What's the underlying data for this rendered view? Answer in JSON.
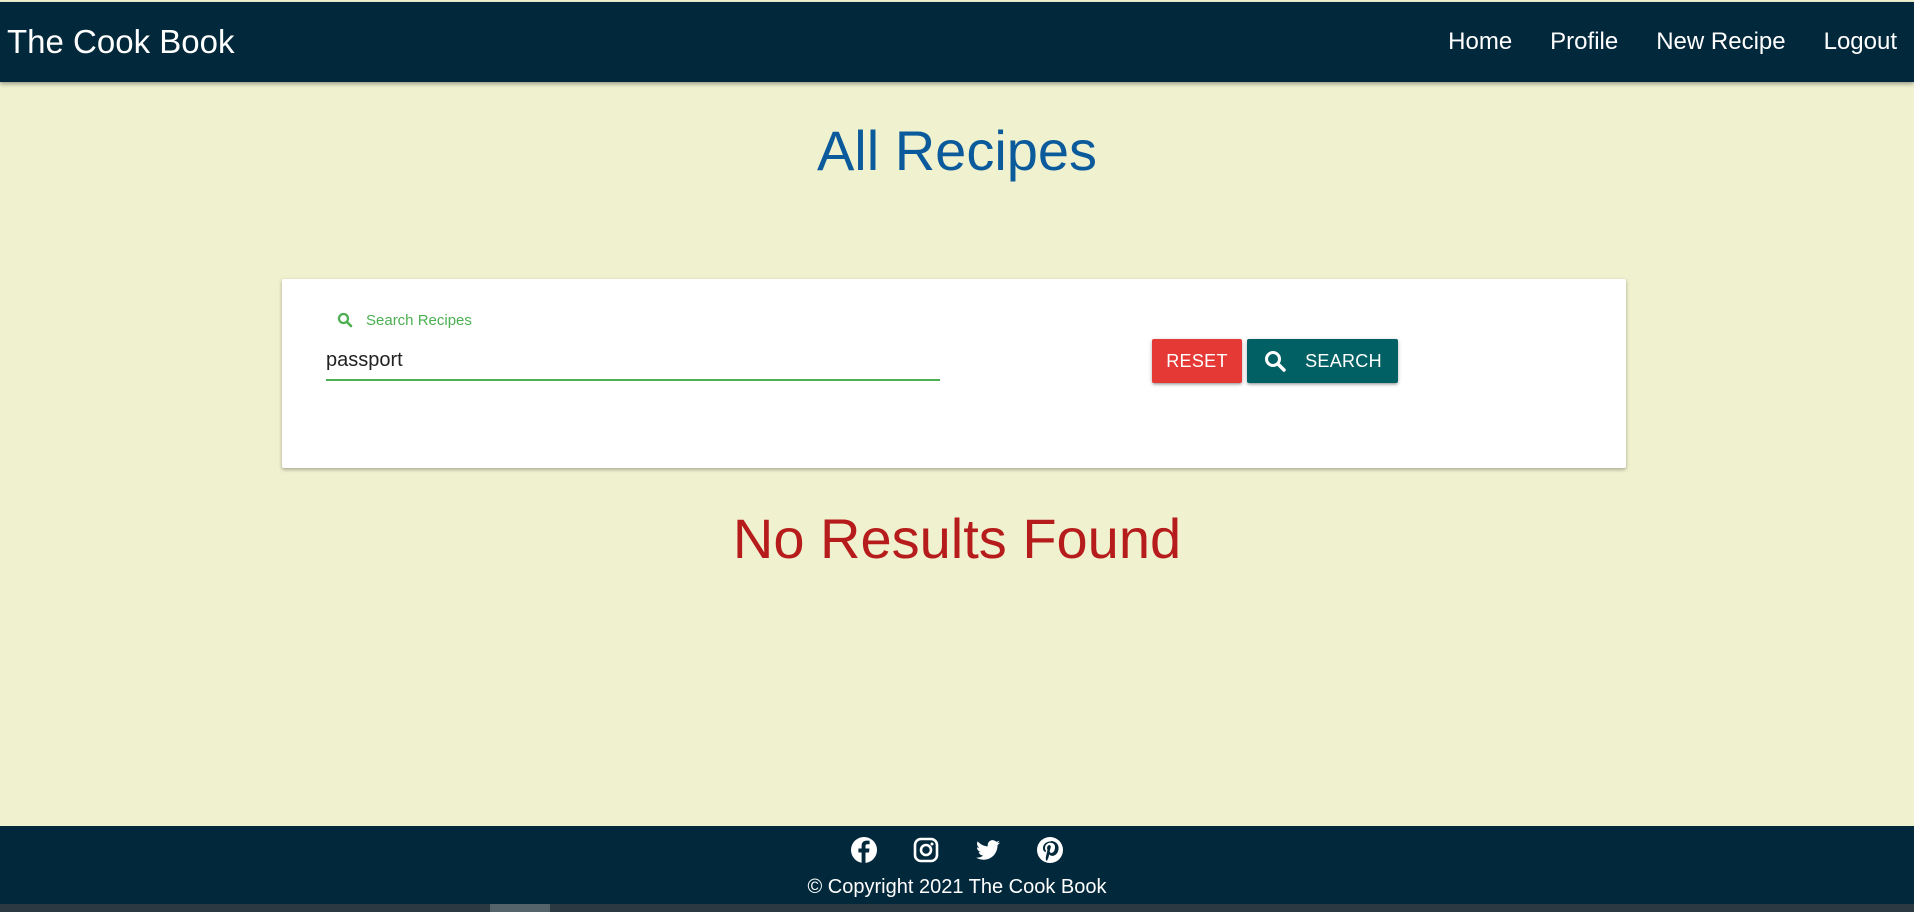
{
  "navbar": {
    "brand": "The Cook Book",
    "links": [
      "Home",
      "Profile",
      "New Recipe",
      "Logout"
    ]
  },
  "main": {
    "title": "All Recipes",
    "search": {
      "label": "Search Recipes",
      "value": "passport",
      "icon": "search-icon"
    },
    "buttons": {
      "reset": "RESET",
      "search": "SEARCH"
    },
    "no_results": "No Results Found"
  },
  "footer": {
    "social": [
      "facebook-icon",
      "instagram-icon",
      "twitter-icon",
      "pinterest-icon"
    ],
    "copyright": "© Copyright 2021 The Cook Book"
  },
  "colors": {
    "navbar": "#02283b",
    "background": "#f0f1cf",
    "title": "#0b5a9b",
    "no_results": "#b71c1c",
    "reset": "#e53935",
    "search": "#006064",
    "field_accent": "#4caf50"
  }
}
